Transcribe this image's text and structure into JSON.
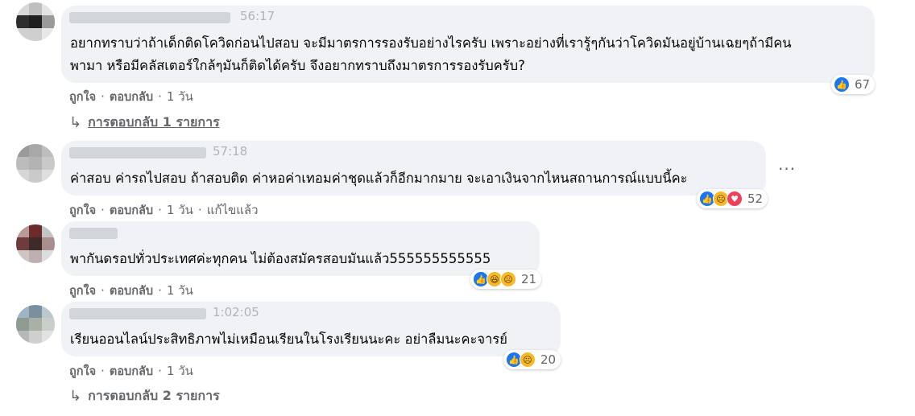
{
  "comments": [
    {
      "timestamp": "56:17",
      "lines": [
        "อยากทราบว่าถ้าเด็กติดโควิดก่อนไปสอบ จะมีมาตรการรองรับอย่างไรครับ เพราะอย่างที่เรารู้ๆกันว่าโควิดมันอยู่บ้านเฉยๆถ้ามีคน",
        "พามา หรือมีคลัสเตอร์ใกล้ๆมันก็ติดได้ครับ จึงอยากทราบถึงมาตรการรองรับครับ?"
      ],
      "reaction_icons": [
        "like"
      ],
      "reaction_count": "67",
      "like_label": "ถูกใจ",
      "reply_label": "ตอบกลับ",
      "time_label": "1 วัน",
      "replies_label": "การตอบกลับ 1 รายการ"
    },
    {
      "timestamp": "57:18",
      "lines": [
        "ค่าสอบ ค่ารถไปสอบ ถ้าสอบติด ค่าหอค่าเทอมค่าชุดแล้วก็อีกมากมาย จะเอาเงินจากไหนสถานการณ์แบบนี้คะ"
      ],
      "reaction_icons": [
        "like",
        "sad",
        "love"
      ],
      "reaction_count": "52",
      "like_label": "ถูกใจ",
      "reply_label": "ตอบกลับ",
      "time_label": "1 วัน",
      "edited_label": "แก้ไขแล้ว",
      "more_label": "···"
    },
    {
      "lines": [
        "พากันดรอปทั่วประเทศค่ะทุกคน ไม่ต้องสมัครสอบมันแล้ว555555555555"
      ],
      "reaction_icons": [
        "like",
        "haha",
        "sad"
      ],
      "reaction_count": "21",
      "like_label": "ถูกใจ",
      "reply_label": "ตอบกลับ",
      "time_label": "1 วัน"
    },
    {
      "timestamp": "1:02:05",
      "lines": [
        "เรียนออนไลน์ประสิทธิภาพไม่เหมือนเรียนในโรงเรียนนะคะ อย่าลืมนะคะจารย์"
      ],
      "reaction_icons": [
        "like",
        "sad"
      ],
      "reaction_count": "20",
      "like_label": "ถูกใจ",
      "reply_label": "ตอบกลับ",
      "time_label": "1 วัน",
      "replies_label": "การตอบกลับ 2 รายการ"
    }
  ],
  "colors": {
    "bubble": "#f0f2f5",
    "meta": "#65676b",
    "like": "#1877f2",
    "timestamp": "#b0b3b8"
  }
}
